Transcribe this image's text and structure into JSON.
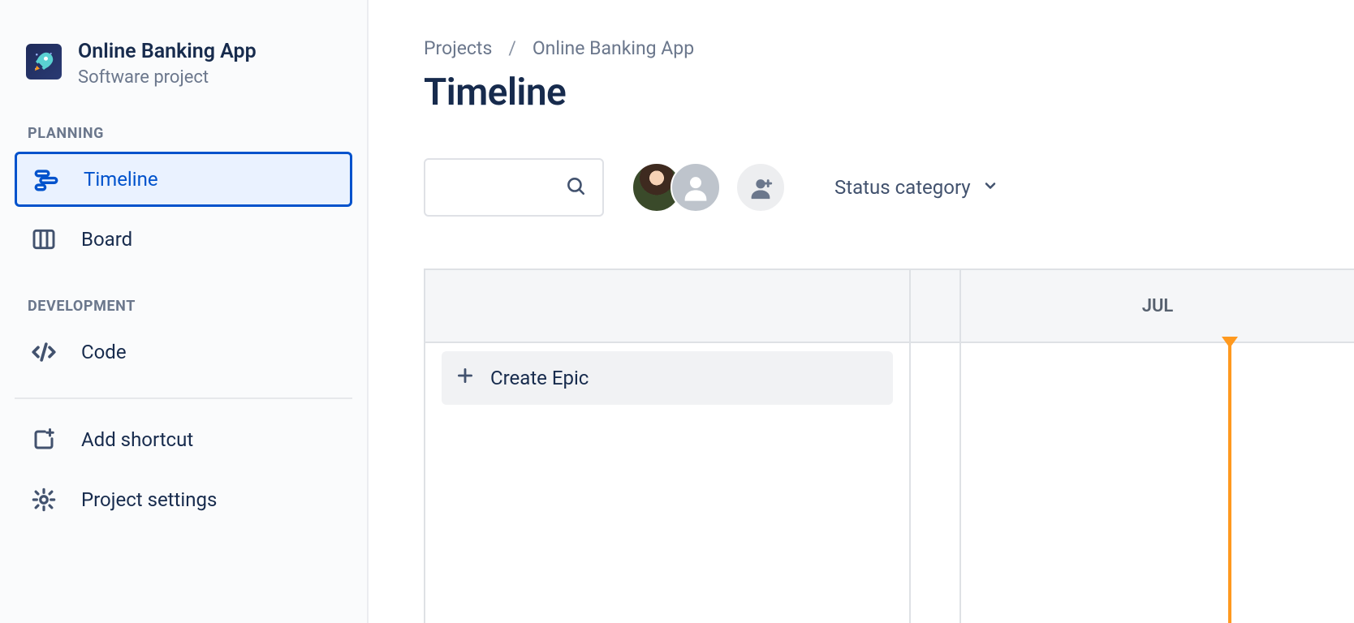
{
  "sidebar": {
    "project_name": "Online Banking App",
    "project_subtitle": "Software project",
    "sections": {
      "planning_label": "PLANNING",
      "development_label": "DEVELOPMENT"
    },
    "items": {
      "timeline": "Timeline",
      "board": "Board",
      "code": "Code",
      "add_shortcut": "Add shortcut",
      "project_settings": "Project settings"
    }
  },
  "breadcrumb": {
    "root": "Projects",
    "separator": "/",
    "current": "Online Banking App"
  },
  "page": {
    "title": "Timeline"
  },
  "toolbar": {
    "search_placeholder": "",
    "filter_label": "Status category"
  },
  "timeline": {
    "create_epic_label": "Create Epic",
    "month_label": "JUL"
  },
  "colors": {
    "accent": "#0052CC",
    "today_marker": "#FF991F"
  }
}
